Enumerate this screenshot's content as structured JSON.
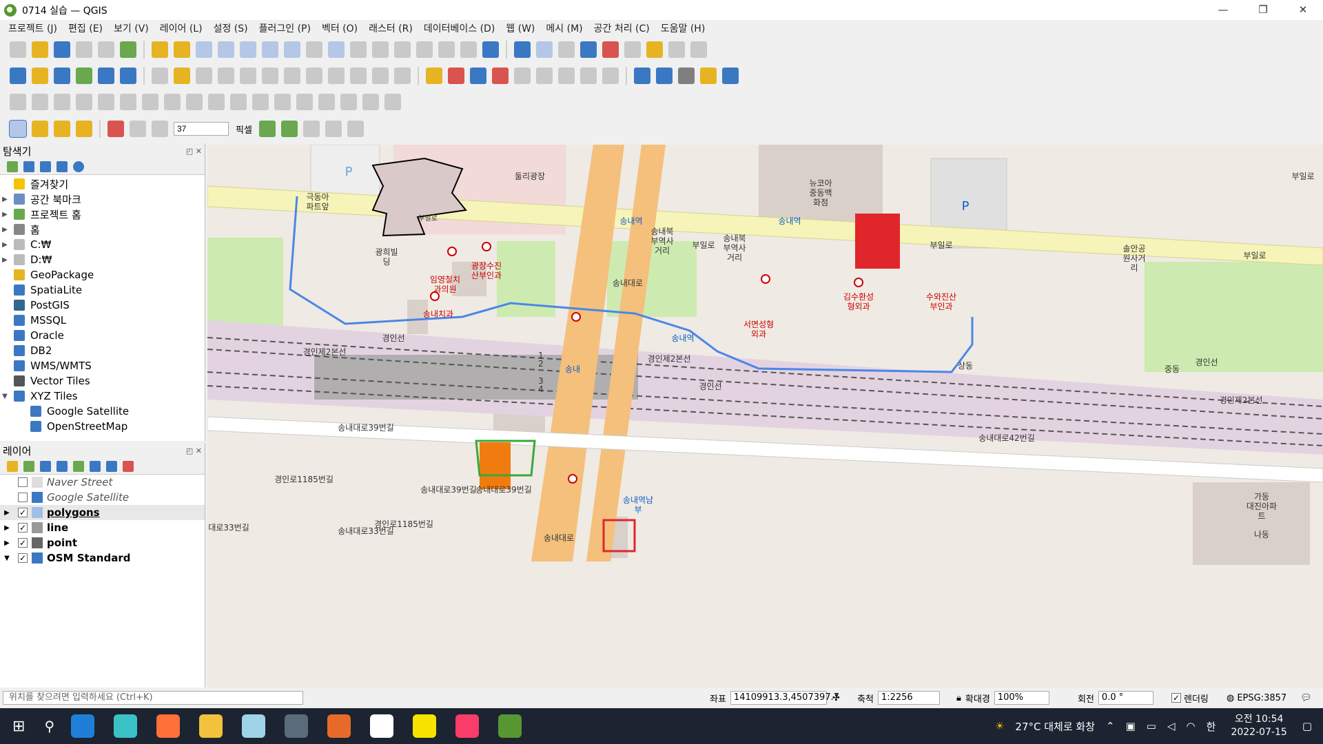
{
  "window": {
    "title": "0714 실습 — QGIS",
    "min": "—",
    "max": "❐",
    "close": "✕"
  },
  "menu": [
    "프로젝트 (J)",
    "편집 (E)",
    "보기 (V)",
    "레이어 (L)",
    "설정 (S)",
    "플러그인 (P)",
    "벡터 (O)",
    "래스터 (R)",
    "데이터베이스 (D)",
    "웹 (W)",
    "메시 (M)",
    "공간 처리 (C)",
    "도움말 (H)"
  ],
  "digitize": {
    "snap_value": "37",
    "snap_unit": "픽셀"
  },
  "browser": {
    "title": "탐색기",
    "items": [
      {
        "label": "즐겨찾기",
        "arrow": "",
        "icon": "star-icon"
      },
      {
        "label": "공간 북마크",
        "arrow": "▶",
        "icon": "bookmark-icon"
      },
      {
        "label": "프로젝트 홈",
        "arrow": "▶",
        "icon": "project-home-icon"
      },
      {
        "label": "홈",
        "arrow": "▶",
        "icon": "home-icon"
      },
      {
        "label": "C:₩",
        "arrow": "▶",
        "icon": "drive-icon"
      },
      {
        "label": "D:₩",
        "arrow": "▶",
        "icon": "drive-icon"
      },
      {
        "label": "GeoPackage",
        "arrow": "",
        "icon": "geopackage-icon"
      },
      {
        "label": "SpatiaLite",
        "arrow": "",
        "icon": "spatialite-icon"
      },
      {
        "label": "PostGIS",
        "arrow": "",
        "icon": "postgis-icon"
      },
      {
        "label": "MSSQL",
        "arrow": "",
        "icon": "mssql-icon"
      },
      {
        "label": "Oracle",
        "arrow": "",
        "icon": "oracle-icon"
      },
      {
        "label": "DB2",
        "arrow": "",
        "icon": "db2-icon"
      },
      {
        "label": "WMS/WMTS",
        "arrow": "",
        "icon": "wms-icon"
      },
      {
        "label": "Vector Tiles",
        "arrow": "",
        "icon": "vector-tiles-icon"
      },
      {
        "label": "XYZ Tiles",
        "arrow": "▼",
        "icon": "xyz-tiles-icon"
      }
    ],
    "children": [
      "Google Satellite",
      "OpenStreetMap"
    ]
  },
  "layers": {
    "title": "레이어",
    "items": [
      {
        "label": "Naver Street",
        "checked": false,
        "style": "italic",
        "arrow": ""
      },
      {
        "label": "Google Satellite",
        "checked": false,
        "style": "italic",
        "arrow": ""
      },
      {
        "label": "polygons",
        "checked": true,
        "style": "bold-underline",
        "arrow": "▶"
      },
      {
        "label": "line",
        "checked": true,
        "style": "bold",
        "arrow": "▶"
      },
      {
        "label": "point",
        "checked": true,
        "style": "bold",
        "arrow": "▶"
      },
      {
        "label": "OSM Standard",
        "checked": true,
        "style": "bold",
        "arrow": "▼"
      }
    ]
  },
  "map_labels": {
    "lbl1": "극동아\n파트앞",
    "lbl2": "둘리광장",
    "lbl3": "뉴코아\n중동백\n화점",
    "lbl4": "송내역",
    "lbl5": "송내북\n부역사\n거리",
    "lbl6": "부일로",
    "lbl7": "송내북\n부역사\n거리",
    "lbl8": "송내역",
    "lbl9": "부일로",
    "lbl10": "솔안공\n원사거\n리",
    "lbl11": "부일로",
    "lbl12": "부일로",
    "lbl13": "광희빌\n딩",
    "lbl14": "임영철치\n과의원",
    "lbl15": "광장수진\n산부인과",
    "lbl16": "김수환성\n형외과",
    "lbl17": "수와진산\n부인과",
    "lbl18": "송내치과",
    "lbl19": "서면성형\n외과",
    "lbl20": "경인선",
    "lbl21": "경인제2본선",
    "lbl22": "송내역",
    "lbl23": "경인제2본선",
    "lbl24": "송내",
    "lbl25": "경인선",
    "lbl26": "상동",
    "lbl27": "경인선",
    "lbl28": "경인제2본선",
    "lbl29": "송내대로39번길",
    "lbl30": "송내대로42번길",
    "lbl31": "경인로1185번길",
    "lbl32": "송내대로39번길",
    "lbl33": "송내대로39번길",
    "lbl34": "송내대로33번길",
    "lbl35": "경인로1185번길",
    "lbl36": "송내대로33번길",
    "lbl37": "송내대로",
    "lbl38": "송내역남\n부",
    "lbl39": "가동\n대진아파\n트",
    "lbl40": "나동",
    "lbl41": "송내대로",
    "lbl42": "중동",
    "lbl43": "부일로",
    "track_1": "1",
    "track_2": "2",
    "track_3": "3",
    "track_4": "4",
    "parking1": "P",
    "parking2": "P"
  },
  "status": {
    "search_placeholder": "위치를 찾으려면 입력하세요 (Ctrl+K)",
    "coord_label": "좌표",
    "coord_value": "14109913.3,4507397.7",
    "scale_label": "축척",
    "scale_value": "1:2256",
    "magnifier_label": "확대경",
    "magnifier_value": "100%",
    "rotation_label": "회전",
    "rotation_value": "0.0 °",
    "render_label": "렌더링",
    "crs": "EPSG:3857"
  },
  "taskbar": {
    "weather": "27°C 대체로 화창",
    "ime": "한",
    "time": "오전 10:54",
    "date": "2022-07-15"
  },
  "colors": {
    "accent": "#589632",
    "polygon_red": "#e0262b",
    "polygon_green": "#3aa83a",
    "polygon_orange": "#f07c10",
    "line_blue": "#4a86e8",
    "rail_pink": "#e3d3e1",
    "road_yellow": "#f6f4b8",
    "road_orange": "#f4c07c"
  }
}
